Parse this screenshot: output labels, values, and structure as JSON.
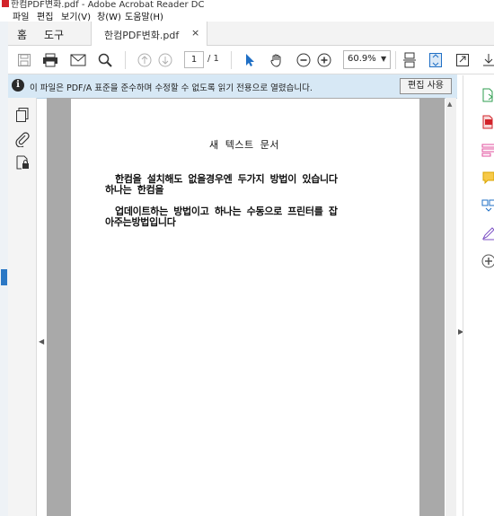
{
  "window": {
    "title": "한컴PDF변화.pdf - Adobe Acrobat Reader DC"
  },
  "menu": [
    "파일",
    "편집",
    "보기(V)",
    "창(W)",
    "도움말(H)"
  ],
  "tabs": {
    "home": "홈",
    "tools": "도구",
    "document": "한컴PDF변화.pdf",
    "close": "×"
  },
  "toolbar": {
    "page_current": "1",
    "page_total": "/ 1",
    "zoom": "60.9%"
  },
  "notice": {
    "message": "이 파일은 PDF/A 표준을 준수하며 수정할 수 없도록 읽기 전용으로 열렸습니다.",
    "button": "편집 사용"
  },
  "document": {
    "title": "새 텍스트 문서",
    "lines": [
      "한컴을 설치해도 없을경우엔 두가지 방법이 있습니다",
      "하나는 한컴을",
      "업데이트하는 방법이고 하나는  수동으로 프린터를 잡",
      "아주는방법입니다"
    ]
  },
  "colors": {
    "accent": "#2b78c5",
    "notice_bg": "#d7e8f5",
    "doc_bg": "#a9a9a9"
  }
}
